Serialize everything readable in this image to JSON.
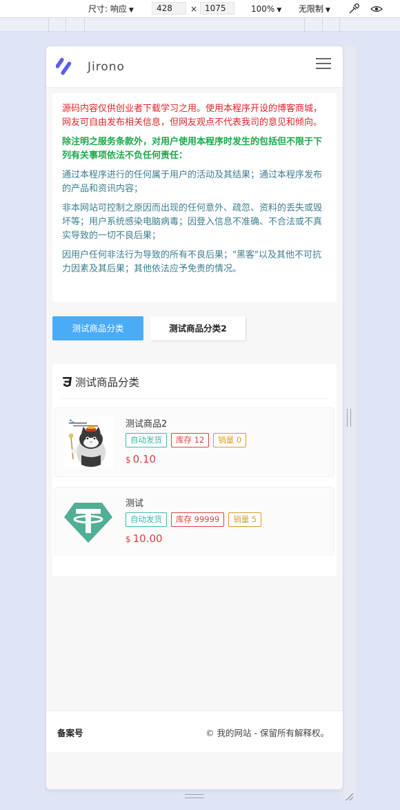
{
  "devtools": {
    "dimensions_label": "尺寸: 响应",
    "width_value": "428",
    "times": "×",
    "height_value": "1075",
    "zoom": "100%",
    "throttle": "无限制"
  },
  "header": {
    "logo_text": "Jirono",
    "brand_color": "#5b5cf0"
  },
  "notice": {
    "intro": "源码内容仅供创业者下载学习之用。使用本程序开设的博客商城，网友可自由发布相关信息，但网友观点不代表我司的意见和倾向。",
    "heading": "除注明之服务条款外，对用户使用本程序时发生的包括但不限于下列有关事项依法不负任何责任：",
    "item1": "通过本程序进行的任何属于用户的活动及其结果；通过本程序发布的产品和资讯内容；",
    "item2": "非本网站可控制之原因而出现的任何意外、疏忽、资料的丢失或毁坏等；用户系统感染电脑病毒；因登入信息不准确、不合法或不真实导致的一切不良后果；",
    "item3": "因用户任何非法行为导致的所有不良后果；\"黑客\"以及其他不可抗力因素及其后果；其他依法应予免责的情况。"
  },
  "categories": {
    "tabs": [
      {
        "label": "测试商品分类",
        "active": true
      },
      {
        "label": "测试商品分类2",
        "active": false
      }
    ]
  },
  "panel": {
    "title": "测试商品分类",
    "products": [
      {
        "name": "测试商品2",
        "tag_auto": "自动发货",
        "tag_stock": "库存 12",
        "tag_sales": "销量 0",
        "currency": "$",
        "price": "0.10",
        "thumb": "cat-image"
      },
      {
        "name": "测试",
        "tag_auto": "自动发货",
        "tag_stock": "库存 99999",
        "tag_sales": "销量 5",
        "currency": "$",
        "price": "10.00",
        "thumb": "tether-logo"
      }
    ]
  },
  "footer": {
    "icp": "备案号",
    "copyright": "© 我的网站 - 保留所有解释权。"
  },
  "colors": {
    "accent_blue": "#4aabf7",
    "notice_red": "#e0242a",
    "notice_green": "#1aa84a",
    "notice_teal": "#3d7d8c",
    "price_red": "#d9413c",
    "tether_green": "#50af95"
  }
}
